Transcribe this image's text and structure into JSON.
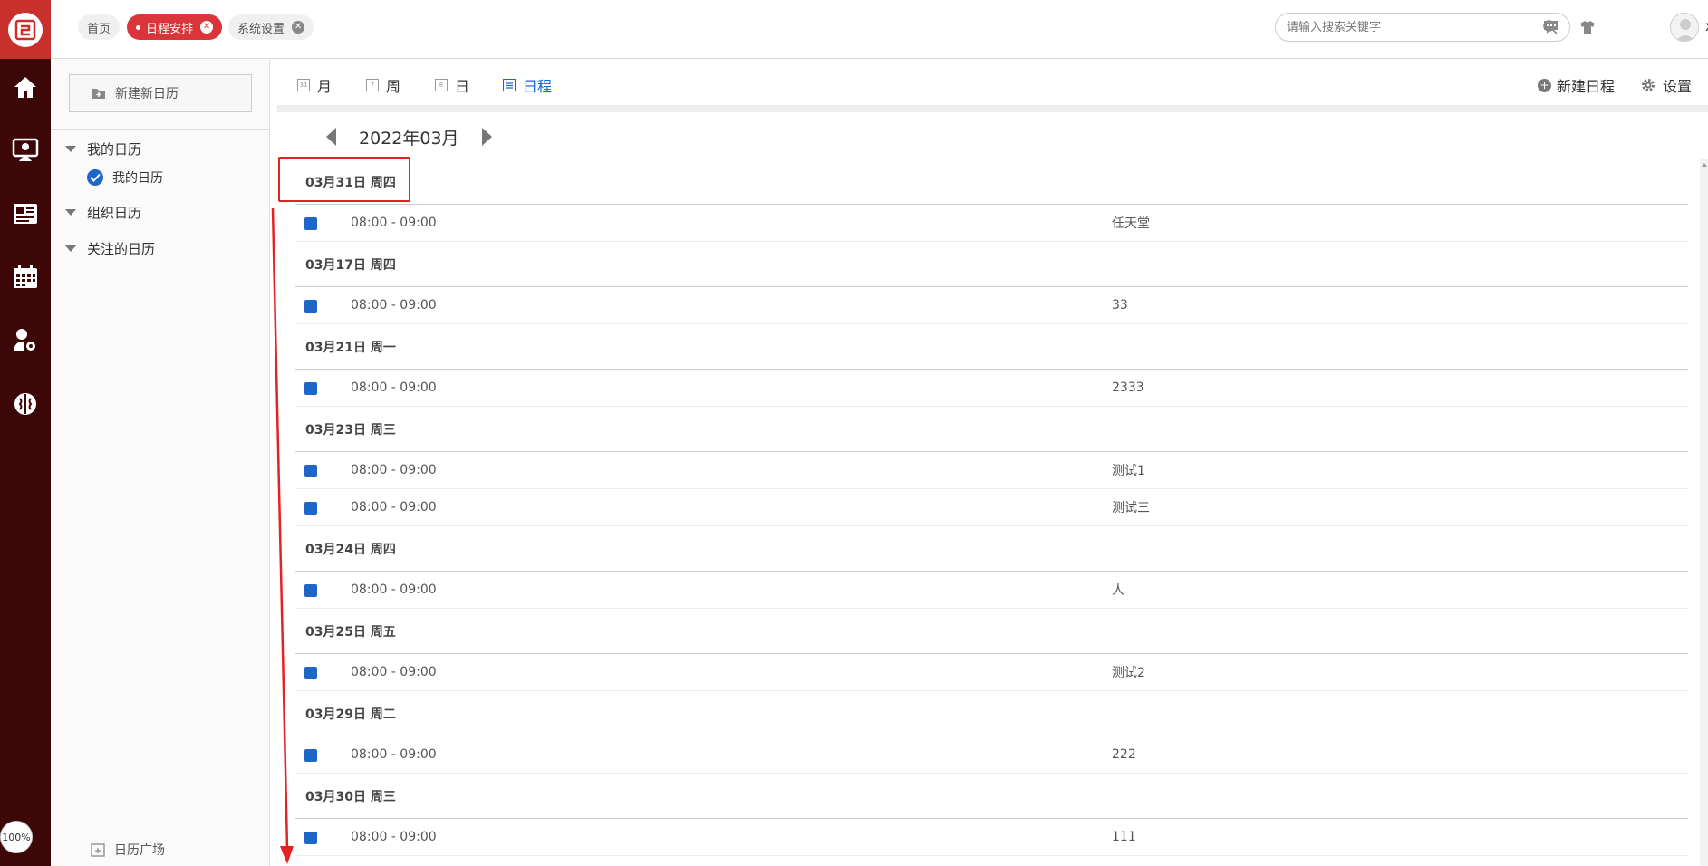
{
  "rail": {
    "zoom": "100%",
    "icons": [
      "home-icon",
      "screen-user-icon",
      "news-icon",
      "calendar-grid-icon",
      "user-settings-icon",
      "brain-icon"
    ],
    "colors": {
      "rail": "#3d0707",
      "logo_bg": "#c9302c"
    }
  },
  "tabs": [
    {
      "label": "首页",
      "active": false,
      "closable": false
    },
    {
      "label": "日程安排",
      "active": true,
      "closable": true
    },
    {
      "label": "系统设置",
      "active": false,
      "closable": true
    }
  ],
  "search": {
    "placeholder": "请输入搜索关键字"
  },
  "user": {
    "name": "xadmin"
  },
  "calendar_panel": {
    "new_calendar": "新建新日历",
    "my_calendars": "我的日历",
    "my_calendar_item": "我的日历",
    "org_calendars": "组织日历",
    "followed_calendars": "关注的日历",
    "plaza": "日历广场"
  },
  "view_tabs": [
    {
      "label": "月",
      "icon_text": "31",
      "active": false
    },
    {
      "label": "周",
      "icon_text": "7",
      "active": false
    },
    {
      "label": "日",
      "icon_text": "8",
      "active": false
    },
    {
      "label": "日程",
      "icon_text": "",
      "active": true
    }
  ],
  "actions": {
    "new_event": "新建日程",
    "settings": "设置"
  },
  "month": {
    "label": "2022年03月"
  },
  "agenda": [
    {
      "date": "03月31日 周四",
      "events": [
        {
          "time": "08:00 - 09:00",
          "title": "任天堂"
        }
      ]
    },
    {
      "date": "03月17日 周四",
      "events": [
        {
          "time": "08:00 - 09:00",
          "title": "33"
        }
      ]
    },
    {
      "date": "03月21日 周一",
      "events": [
        {
          "time": "08:00 - 09:00",
          "title": "2333"
        }
      ]
    },
    {
      "date": "03月23日 周三",
      "events": [
        {
          "time": "08:00 - 09:00",
          "title": "测试1"
        },
        {
          "time": "08:00 - 09:00",
          "title": "测试三"
        }
      ]
    },
    {
      "date": "03月24日 周四",
      "events": [
        {
          "time": "08:00 - 09:00",
          "title": "人"
        }
      ]
    },
    {
      "date": "03月25日 周五",
      "events": [
        {
          "time": "08:00 - 09:00",
          "title": "测试2"
        }
      ]
    },
    {
      "date": "03月29日 周二",
      "events": [
        {
          "time": "08:00 - 09:00",
          "title": "222"
        }
      ]
    },
    {
      "date": "03月30日 周三",
      "events": [
        {
          "time": "08:00 - 09:00",
          "title": "111"
        }
      ]
    }
  ],
  "colors": {
    "accent": "#d9353a",
    "event": "#1e66c8",
    "annotation": "#e52222"
  }
}
